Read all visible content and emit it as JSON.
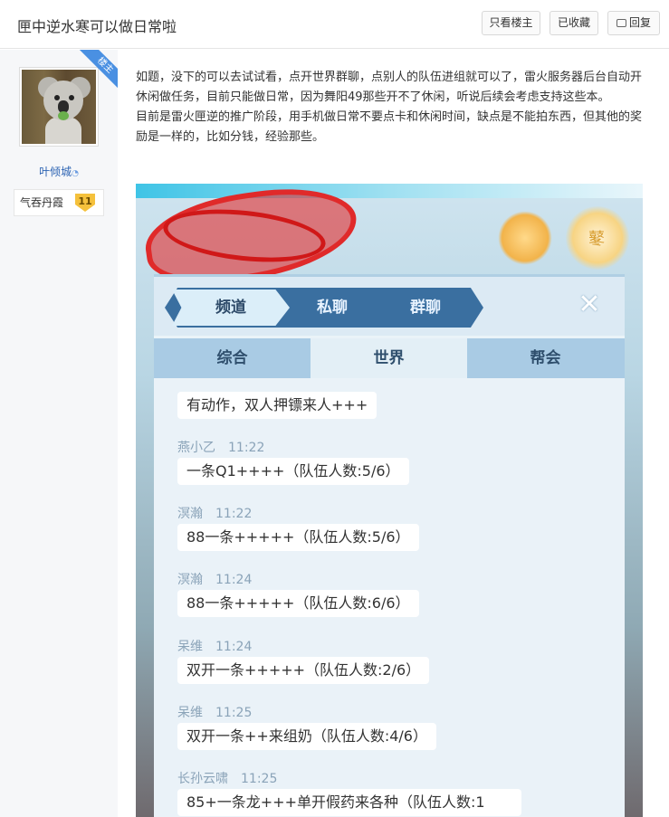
{
  "header": {
    "title": "匣中逆水寒可以做日常啦",
    "only_op_label": "只看楼主",
    "fav_label": "已收藏",
    "reply_label": "回复"
  },
  "author": {
    "badge": "楼主",
    "username": "叶倾城",
    "level_name": "气吞丹霞",
    "level": "11"
  },
  "post": {
    "paragraphs": [
      "如题，没下的可以去试试看，点开世界群聊，点别人的队伍进组就可以了，雷火服务器后台自动开休闲做任务，目前只能做日常，因为舞阳49那些开不了休闲，听说后续会考虑支持这些本。",
      "目前是雷火匣逆的推广阶段，用手机做日常不要点卡和休闲时间，缺点是不能拍东西，但其他的奖励是一样的，比如分钱，经验那些。"
    ]
  },
  "screenshot": {
    "deco_char": "鼕",
    "top_tabs": [
      "频道",
      "私聊",
      "群聊"
    ],
    "close": "✕",
    "sub_tabs": [
      "综合",
      "世界",
      "帮会"
    ],
    "messages": [
      {
        "name": "",
        "time": "",
        "text": "有动作，双人押镖来人+++"
      },
      {
        "name": "燕小乙",
        "time": "11:22",
        "text": "一条Q1++++（队伍人数:5/6）"
      },
      {
        "name": "溟瀚",
        "time": "11:22",
        "text": "88一条+++++（队伍人数:5/6）"
      },
      {
        "name": "溟瀚",
        "time": "11:24",
        "text": "88一条+++++（队伍人数:6/6）"
      },
      {
        "name": "呆维",
        "time": "11:24",
        "text": "双开一条+++++（队伍人数:2/6）"
      },
      {
        "name": "呆维",
        "time": "11:25",
        "text": "双开一条++来组奶（队伍人数:4/6）"
      },
      {
        "name": "长孙云啸",
        "time": "11:25",
        "text": "85+一条龙+++单开假药来各种（队伍人数:1"
      }
    ]
  }
}
